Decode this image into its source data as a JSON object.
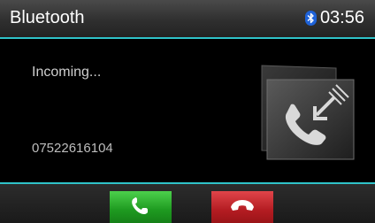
{
  "header": {
    "title": "Bluetooth",
    "bluetooth_icon": "bluetooth-icon",
    "time": "03:56",
    "accent_color": "#2fc3c9"
  },
  "call": {
    "status": "Incoming...",
    "number": "07522616104",
    "caller_image_icon": "incoming-call-icon"
  },
  "footer": {
    "accept_icon": "phone-accept-icon",
    "reject_icon": "phone-hangup-icon",
    "accept_color": "#22a524",
    "reject_color": "#c0232a"
  }
}
